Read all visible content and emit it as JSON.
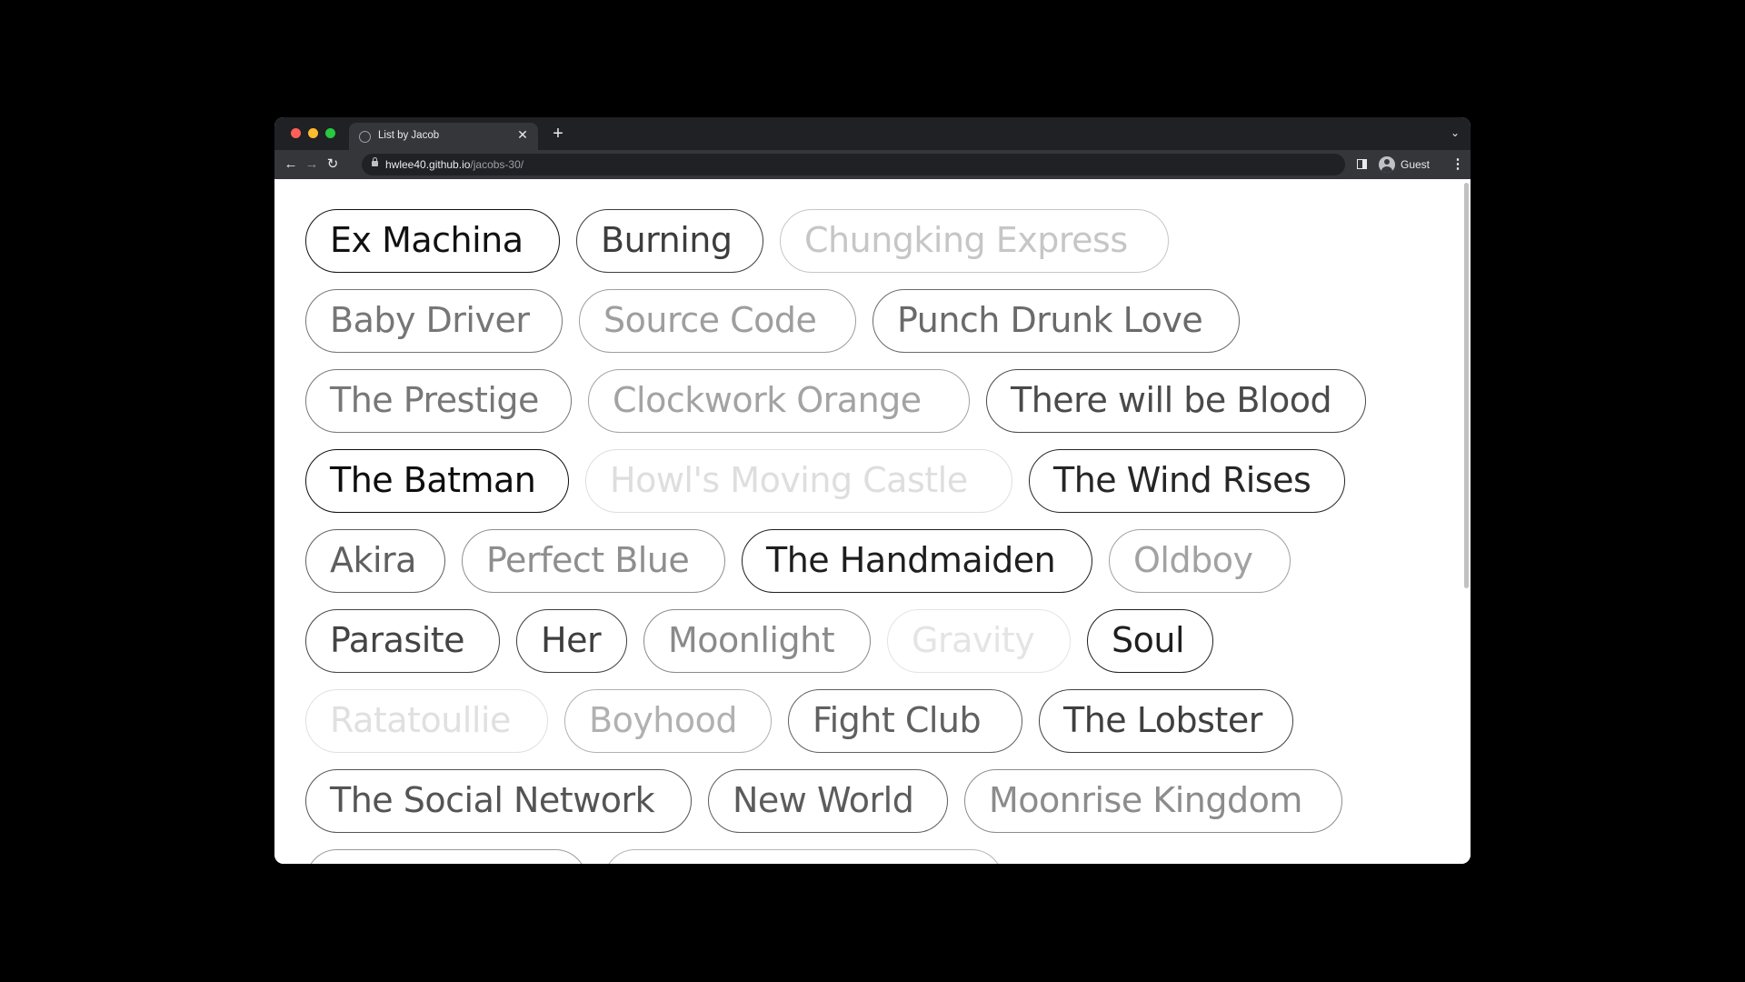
{
  "browser": {
    "tab_title": "List by Jacob",
    "new_tab_label": "+",
    "url_host": "hwlee40.github.io",
    "url_path": "/jacobs-30/",
    "profile_label": "Guest",
    "traffic_light_colors": [
      "#ff5f57",
      "#febc2e",
      "#28c840"
    ]
  },
  "films": [
    {
      "title": "Ex Machina",
      "color": "#111111"
    },
    {
      "title": "Burning",
      "color": "#3d3d3d"
    },
    {
      "title": "Chungking Express",
      "color": "#c6c6c6"
    },
    {
      "title": "Baby Driver",
      "color": "#767676"
    },
    {
      "title": "Source Code",
      "color": "#9e9e9e"
    },
    {
      "title": "Punch Drunk Love",
      "color": "#6a6a6a"
    },
    {
      "title": "The Prestige",
      "color": "#777777"
    },
    {
      "title": "Clockwork Orange",
      "color": "#a3a3a3"
    },
    {
      "title": "There will be Blood",
      "color": "#4a4a4a"
    },
    {
      "title": "The Batman",
      "color": "#0d0d0d"
    },
    {
      "title": "Howl's Moving Castle",
      "color": "#dedede"
    },
    {
      "title": "The Wind Rises",
      "color": "#262626"
    },
    {
      "title": "Akira",
      "color": "#5f5f5f"
    },
    {
      "title": "Perfect Blue",
      "color": "#8e8e8e"
    },
    {
      "title": "The Handmaiden",
      "color": "#1e1e1e"
    },
    {
      "title": "Oldboy",
      "color": "#a2a2a2"
    },
    {
      "title": "Parasite",
      "color": "#444444"
    },
    {
      "title": "Her",
      "color": "#3e3e3e"
    },
    {
      "title": "Moonlight",
      "color": "#8a8a8a"
    },
    {
      "title": "Gravity",
      "color": "#e4e4e4"
    },
    {
      "title": "Soul",
      "color": "#1f1f1f"
    },
    {
      "title": "Ratatoullie",
      "color": "#e0e0e0"
    },
    {
      "title": "Boyhood",
      "color": "#b1b1b1"
    },
    {
      "title": "Fight Club",
      "color": "#606060"
    },
    {
      "title": "The Lobster",
      "color": "#3f3f3f"
    },
    {
      "title": "The Social Network",
      "color": "#545454"
    },
    {
      "title": "New World",
      "color": "#5c5c5c"
    },
    {
      "title": "Moonrise Kingdom",
      "color": "#8c8c8c"
    },
    {
      "title": "",
      "color": "#9a9a9a"
    },
    {
      "title": "",
      "color": "#b5b5b5"
    }
  ]
}
